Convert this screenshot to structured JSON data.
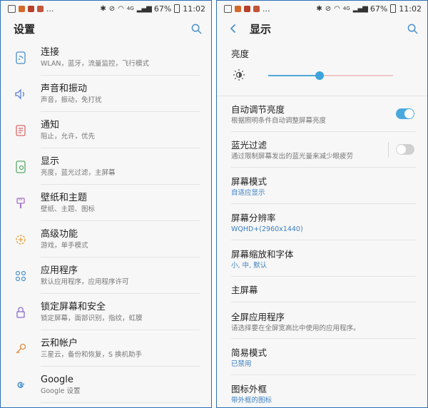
{
  "left": {
    "status": {
      "time": "11:02",
      "battery": "67%",
      "network": "4G",
      "ellipsis": "..."
    },
    "title": "设置",
    "items": [
      {
        "label": "连接",
        "sub": "WLAN，蓝牙，流量监控，飞行模式",
        "icon": "connection-icon"
      },
      {
        "label": "声音和振动",
        "sub": "声音，振动，免打扰",
        "icon": "speaker-icon"
      },
      {
        "label": "通知",
        "sub": "阻止，允许，优先",
        "icon": "notification-icon"
      },
      {
        "label": "显示",
        "sub": "亮度，蓝光过滤，主屏幕",
        "icon": "display-icon"
      },
      {
        "label": "壁纸和主题",
        "sub": "壁纸、主题、图标",
        "icon": "brush-icon"
      },
      {
        "label": "高级功能",
        "sub": "游戏，单手模式",
        "icon": "advanced-gear-icon"
      },
      {
        "label": "应用程序",
        "sub": "默认应用程序，应用程序许可",
        "icon": "apps-grid-icon"
      },
      {
        "label": "锁定屏幕和安全",
        "sub": "锁定屏幕，面部识别，指纹，虹膜",
        "icon": "lock-icon"
      },
      {
        "label": "云和帐户",
        "sub": "三星云，备份和恢复，S 换机助手",
        "icon": "key-icon"
      },
      {
        "label": "Google",
        "sub": "Google 设置",
        "icon": "google-icon"
      }
    ]
  },
  "right": {
    "status": {
      "time": "11:02",
      "battery": "67%",
      "network": "4G",
      "ellipsis": "..."
    },
    "title": "显示",
    "brightness": {
      "label": "亮度",
      "value": 0.41
    },
    "items": [
      {
        "label": "自动调节亮度",
        "sub": "根据照明条件自动调整屏幕亮度",
        "toggle": true
      },
      {
        "label": "蓝光过滤",
        "sub": "通过限制屏幕发出的蓝光量来减少眼疲劳",
        "toggle": false
      },
      {
        "label": "屏幕模式",
        "sub": "自适应显示",
        "blue": true
      },
      {
        "label": "屏幕分辨率",
        "sub": "WQHD+(2960x1440)",
        "blue": true
      },
      {
        "label": "屏幕缩放和字体",
        "sub": "小, 中, 默认",
        "blue": true
      },
      {
        "label": "主屏幕",
        "sub": ""
      },
      {
        "label": "全屏应用程序",
        "sub": "请选择要在全屏宽高比中使用的应用程序。"
      },
      {
        "label": "简易模式",
        "sub": "已禁用",
        "blue": true
      },
      {
        "label": "图标外框",
        "sub": "带外框的图标",
        "blue": true
      }
    ]
  },
  "colors": {
    "accent": "#4aa8dc",
    "blue_text": "#3b7fbf",
    "toggle_off": "#d0d0d0"
  }
}
